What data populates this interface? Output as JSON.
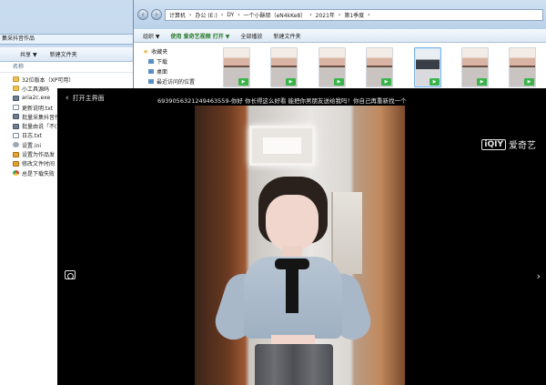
{
  "left_window": {
    "tab_label": "集采抖音作品",
    "toolbar": {
      "share_label": "共享",
      "share_arrow": "▼",
      "new_folder_label": "新建文件夹"
    },
    "column_header": "名称",
    "files": [
      {
        "name": "32位版本（XP可用）",
        "icon": "folder"
      },
      {
        "name": "小工具源码",
        "icon": "folder"
      },
      {
        "name": "aria2c.exe",
        "icon": "exe"
      },
      {
        "name": "更新说明.txt",
        "icon": "txt"
      },
      {
        "name": "批量采集抖音作",
        "icon": "exe"
      },
      {
        "name": "批量由说「不(",
        "icon": "exe"
      },
      {
        "name": "日志.txt",
        "icon": "txt"
      },
      {
        "name": "设置.ini",
        "icon": "gear"
      },
      {
        "name": "设置为作品发",
        "icon": "bat"
      },
      {
        "name": "修改文件时间",
        "icon": "bat"
      },
      {
        "name": "总是下载失败",
        "icon": "chrome"
      }
    ]
  },
  "right_window": {
    "breadcrumb": [
      "计算机",
      "办公 (E:)",
      "DY",
      "一个小酥耶（eN4kKe8）",
      "2021年",
      "第1季度"
    ],
    "toolbar": {
      "organize_label": "组织 ▼",
      "open_with_label": "使用 爱奇艺视频 打开 ▼",
      "play_all_label": "全部播放",
      "new_folder_label": "新建文件夹"
    },
    "sidebar": {
      "favorites_label": "收藏夹",
      "items": [
        "下载",
        "桌面",
        "最近访问的位置"
      ]
    },
    "thumbnail_badge": "▶"
  },
  "player": {
    "home_label": "打开主界面",
    "title": "693905632124946355­9-你好 你长得这么好看 能把你男朋友送给我吗！你自己再重新找一个",
    "logo_mark": "iQIY",
    "logo_text": "爱奇艺",
    "next_glyph": "›"
  }
}
